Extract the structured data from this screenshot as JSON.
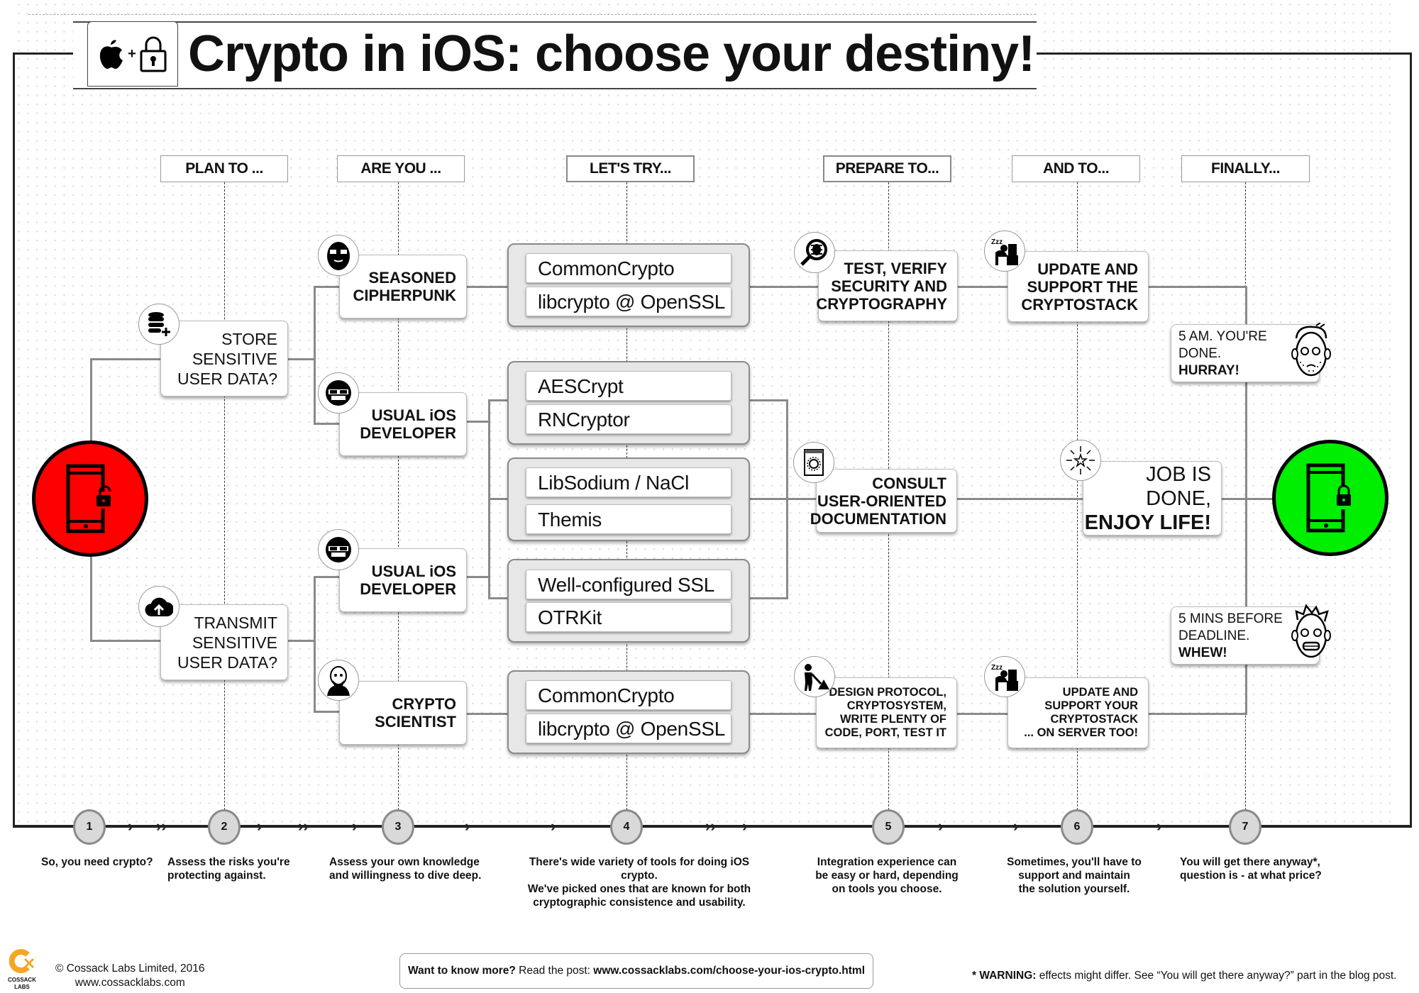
{
  "title": "Crypto in iOS: choose your destiny!",
  "logo_icons": [
    "apple-icon",
    "plus-icon",
    "padlock-icon"
  ],
  "colors": {
    "start": "#ff0000",
    "end": "#00ee00",
    "brand": "#f5a623",
    "step_fill": "#d9d9d9",
    "step_border": "#8a8a8a",
    "group_fill": "#e7e7e7"
  },
  "headers": [
    "PLAN TO ...",
    "ARE YOU ...",
    "LET'S TRY...",
    "PREPARE TO...",
    "AND TO...",
    "FINALLY..."
  ],
  "start_node": {
    "icon": "phone-unlocked-icon",
    "state": "unsecured"
  },
  "end_node": {
    "icon": "phone-locked-icon",
    "state": "secured"
  },
  "plans": [
    {
      "icon": "database-add-icon",
      "text": "STORE\nSENSITIVE\nUSER DATA?"
    },
    {
      "icon": "cloud-upload-icon",
      "text": "TRANSMIT\nSENSITIVE\nUSER DATA?"
    }
  ],
  "personas": [
    {
      "icon": "bearded-glasses-avatar-icon",
      "text": "SEASONED\nCIPHERPUNK"
    },
    {
      "icon": "sunglasses-avatar-icon",
      "text": "USUAL iOS\nDEVELOPER"
    },
    {
      "icon": "sunglasses-avatar-icon",
      "text": "USUAL iOS\nDEVELOPER"
    },
    {
      "icon": "bald-scientist-avatar-icon",
      "text": "CRYPTO\nSCIENTIST"
    }
  ],
  "library_groups": [
    {
      "items": [
        "CommonCrypto",
        "libcrypto @ OpenSSL"
      ]
    },
    {
      "items": [
        "AESCrypt",
        "RNCryptor"
      ]
    },
    {
      "items": [
        "LibSodium / NaCl",
        "Themis"
      ]
    },
    {
      "items": [
        "Well-configured SSL",
        "OTRKit"
      ]
    },
    {
      "items": [
        "CommonCrypto",
        "libcrypto @ OpenSSL"
      ]
    }
  ],
  "prepare": [
    {
      "icon": "bug-magnifier-icon",
      "text": "TEST, VERIFY\nSECURITY AND\nCRYPTOGRAPHY"
    },
    {
      "icon": "manual-gear-icon",
      "text": "CONSULT\nUSER-ORIENTED\nDOCUMENTATION"
    },
    {
      "icon": "construction-worker-icon",
      "text": "DESIGN PROTOCOL,\nCRYPTOSYSTEM,\nWRITE PLENTY OF\nCODE, PORT, TEST IT"
    }
  ],
  "and_to": [
    {
      "icon": "sleepy-worker-icon",
      "text": "UPDATE AND\nSUPPORT THE\nCRYPTOSTACK"
    },
    {
      "icon": "fireworks-star-icon",
      "line1": "JOB IS DONE,",
      "line2": "ENJOY LIFE!"
    },
    {
      "icon": "sleepy-worker-icon",
      "text": "UPDATE AND\nSUPPORT YOUR\nCRYPTOSTACK\n... ON SERVER TOO!"
    }
  ],
  "finally": [
    {
      "icon": "tired-face-icon",
      "line1": "5 AM. YOU'RE",
      "line2": "DONE.",
      "bold": "HURRAY!"
    },
    {
      "icon": "stressed-face-icon",
      "line1": "5 MINS BEFORE",
      "line2": "DEADLINE.",
      "bold": "WHEW!"
    }
  ],
  "steps": [
    {
      "num": "1",
      "desc": "So, you need crypto?"
    },
    {
      "num": "2",
      "desc": "Assess the risks you're\nprotecting against."
    },
    {
      "num": "3",
      "desc": "Assess your own knowledge\nand willingness to dive deep."
    },
    {
      "num": "4",
      "desc": "There's wide variety of tools for doing iOS crypto.\nWe've picked ones that are known for both\ncryptographic consistence and usability."
    },
    {
      "num": "5",
      "desc": "Integration experience can\nbe easy or hard, depending\non tools you choose."
    },
    {
      "num": "6",
      "desc": "Sometimes, you'll have to\nsupport and maintain\nthe solution yourself."
    },
    {
      "num": "7",
      "desc": "You will get there anyway*,\nquestion is - at what price?"
    }
  ],
  "footer": {
    "brand_line1": "COSSACK",
    "brand_line2": "LABS",
    "copyright": "© Cossack Labs Limited, 2016",
    "website": "www.cossacklabs.com",
    "cta_bold": "Want to know more?",
    "cta_text": " Read the post: ",
    "cta_link": "www.cossacklabs.com/choose-your-ios-crypto.html",
    "warning_bold": "* WARNING:",
    "warning_text": " effects might differ. See “You will get there anyway?” part in the blog post."
  }
}
